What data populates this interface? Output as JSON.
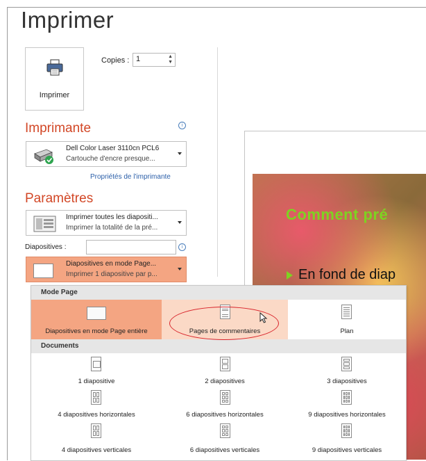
{
  "page_title": "Imprimer",
  "print_button": {
    "label": "Imprimer",
    "icon": "printer-icon"
  },
  "copies": {
    "label": "Copies :",
    "value": "1"
  },
  "printer_section": {
    "title": "Imprimante",
    "name": "Dell Color Laser 3110cn PCL6",
    "status": "Cartouche d'encre presque...",
    "properties_link": "Propriétés de l'imprimante"
  },
  "settings_section": {
    "title": "Paramètres",
    "range_line1": "Imprimer toutes les diapositi...",
    "range_line2": "Imprimer la totalité de la pré...",
    "slides_label": "Diapositives :",
    "slides_value": "",
    "layout_line1": "Diapositives en mode Page...",
    "layout_line2": "Imprimer 1 diapositive par p..."
  },
  "preview": {
    "title": "Comment pré",
    "bullet": "En fond de diap"
  },
  "layout_menu": {
    "mode_page_header": "Mode Page",
    "mode_items": [
      "Diapositives en mode Page entière",
      "Pages de commentaires",
      "Plan"
    ],
    "documents_header": "Documents",
    "documents_row1": [
      "1 diapositive",
      "2 diapositives",
      "3 diapositives"
    ],
    "documents_row2": [
      "4 diapositives horizontales",
      "6 diapositives horizontales",
      "9 diapositives horizontales"
    ],
    "documents_row3": [
      "4 diapositives verticales",
      "6 diapositives verticales",
      "9 diapositives verticales"
    ]
  },
  "colors": {
    "accent": "#d24726",
    "selection": "#f4a582",
    "preview_title": "#7ed321",
    "annotation": "#d8232a"
  }
}
